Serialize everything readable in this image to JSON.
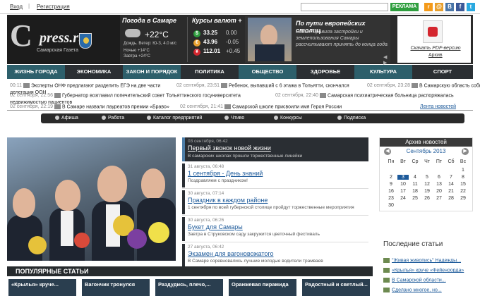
{
  "top": {
    "login": "Вход",
    "register": "Регистрация",
    "ad": "РЕКЛАМА"
  },
  "social": [
    {
      "name": "rss-icon",
      "color": "#f49a1a",
      "glyph": "r"
    },
    {
      "name": "mail-icon",
      "color": "#e8a02e",
      "glyph": "@"
    },
    {
      "name": "vk-icon",
      "color": "#4a76a8",
      "glyph": "B"
    },
    {
      "name": "facebook-icon",
      "color": "#3b5998",
      "glyph": "f"
    },
    {
      "name": "twitter-icon",
      "color": "#2aa9e0",
      "glyph": "t"
    }
  ],
  "logo": {
    "letter": "С",
    "name": "press.ru",
    "sub": "Самарская Газета"
  },
  "weather": {
    "title": "Погода в Самаре",
    "temp": "+22°C",
    "wind": "Дождь. Ветер: Ю-З, 4.0 м/с",
    "night": "Ночью +14°C",
    "tomorrow": "Завтра +24°C"
  },
  "fx": {
    "title": "Курсы валют +",
    "rows": [
      {
        "sym": "$",
        "value": "33.25",
        "delta": "0.00",
        "color": "#2e9e3e"
      },
      {
        "sym": "€",
        "value": "43.96",
        "delta": "-0.05",
        "color": "#e8a02e"
      },
      {
        "sym": "¥",
        "value": "112.01",
        "delta": "+0.45",
        "color": "#d4262e"
      }
    ]
  },
  "featured": {
    "title": "По пути европейских столиц",
    "text": "Новые Правила застройки и землепользования Самары рассчитывают принять до конца года"
  },
  "pdf": {
    "link": "Скачать PDF-версию",
    "archive": "Архив"
  },
  "nav": [
    {
      "label": "ЖИЗНЬ ГОРОДА",
      "bg": "#2d5f6b"
    },
    {
      "label": "ЭКОНОМИКА",
      "bg": "#2b2f33"
    },
    {
      "label": "ЗАКОН И ПОРЯДОК",
      "bg": "#2d5f6b"
    },
    {
      "label": "ПОЛИТИКА",
      "bg": "#2b2f33"
    },
    {
      "label": "ОБЩЕСТВО",
      "bg": "#2d5f6b"
    },
    {
      "label": "ЗДОРОВЬЕ",
      "bg": "#2b2f33"
    },
    {
      "label": "КУЛЬТУРА",
      "bg": "#2d5f6b"
    },
    {
      "label": "СПОРТ",
      "bg": "#2b2f33"
    }
  ],
  "ticker": [
    {
      "date": "00:11",
      "text": "Эксперты ОНФ предлагают разделить ЕГЭ на две части"
    },
    {
      "date": "02 сентября, 23:51",
      "text": "Ребенок, выпавший с 6 этажа в Тольятти, скончался"
    },
    {
      "date": "02 сентября, 23:28",
      "text": "В Самарскую область собирается"
    },
    {
      "date": "",
      "text": "делегация ООН"
    },
    {
      "date": "02 сентября, 22:56",
      "text": "Губернатор возглавил попечительский совет Тольяттинского госуниверситета"
    },
    {
      "date": "02 сентября, 22:40",
      "text": "Самарская психиатрическая больница распоряжалась"
    },
    {
      "date": "",
      "text": "недвижимостью пациентов"
    },
    {
      "date": "02 сентября, 22:19",
      "text": "В Самаре назвали лауреатов премии «Браво»"
    },
    {
      "date": "02 сентября, 21:41",
      "text": "Самарской школе присвоили имя Героя России"
    },
    {
      "date": "",
      "text": "Лента новостей"
    }
  ],
  "nav2": [
    "Афиша",
    "Работа",
    "Каталог предприятий",
    "Чтиво",
    "Конкурсы",
    "Подписка"
  ],
  "lead": {
    "date": "03 сентября, 06:42",
    "title": "Первый звонок новой жизни",
    "text": "В самарских школах прошли торжественные линейки"
  },
  "stories": [
    {
      "date": "31 августа, 06:48",
      "title": "1 сентября - День знаний",
      "text": "Поздравляем с праздником!"
    },
    {
      "date": "30 августа, 07:14",
      "title": "Праздник в каждом районе",
      "text": "1 сентября по всей губернской столице пройдут торжественные мероприятия"
    },
    {
      "date": "30 августа, 06:26",
      "title": "Букет для Самары",
      "text": "Завтра в Струковском саду закружится цветочный фестиваль"
    },
    {
      "date": "27 августа, 06:42",
      "title": "Экзамен для вагоновожатого",
      "text": "В Самаре соревновались лучшие молодые водители трамваев"
    }
  ],
  "popular": {
    "title": "ПОПУЛЯРНЫЕ СТАТЬИ",
    "items": [
      "«Крылья» круче...",
      "Вагончик тронулся",
      "Раздудись, плечо,...",
      "Оранжевая пирамида",
      "Радостный и светлый..."
    ]
  },
  "archive": {
    "title": "Архив новостей",
    "month": "Сентябрь 2013",
    "days_header": [
      "Пн",
      "Вт",
      "Ср",
      "Чт",
      "Пт",
      "Сб",
      "Вс"
    ],
    "weeks": [
      [
        "",
        "",
        "",
        "",
        "",
        "",
        "1"
      ],
      [
        "2",
        "3",
        "4",
        "5",
        "6",
        "7",
        "8"
      ],
      [
        "9",
        "10",
        "11",
        "12",
        "13",
        "14",
        "15"
      ],
      [
        "16",
        "17",
        "18",
        "19",
        "20",
        "21",
        "22"
      ],
      [
        "23",
        "24",
        "25",
        "26",
        "27",
        "28",
        "29"
      ],
      [
        "30",
        "",
        "",
        "",
        "",
        "",
        ""
      ]
    ],
    "active": "3"
  },
  "latest": {
    "title": "Последние статьи",
    "items": [
      "\"Живая живопись\" Надежды...",
      "«Крылья» круче «Фейеноорда»",
      "В Самарской области...",
      "Сделано многое, но..."
    ]
  }
}
